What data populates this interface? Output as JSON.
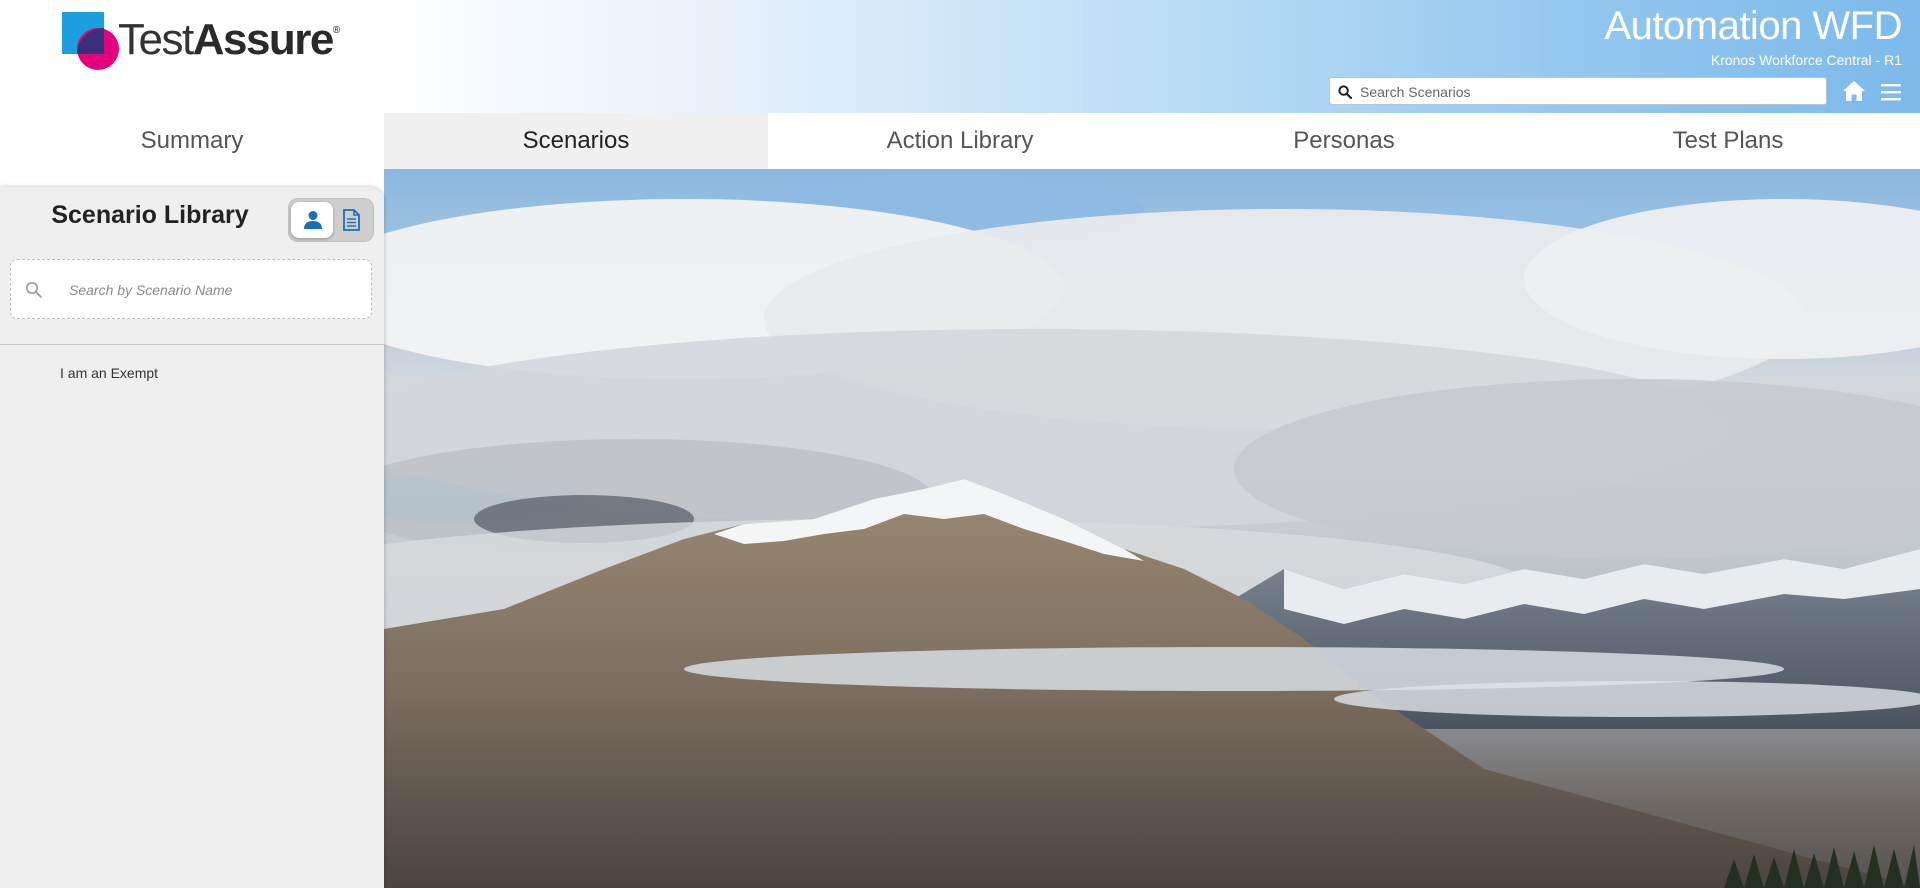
{
  "header": {
    "logo_text_light": "Test",
    "logo_text_bold": "Assure",
    "logo_registered": "®",
    "app_title": "Automation WFD",
    "app_subtitle": "Kronos Workforce Central - R1",
    "search_placeholder": "Search Scenarios",
    "icons": {
      "search": "search-icon",
      "home": "home-icon",
      "menu": "hamburger-menu-icon"
    }
  },
  "nav": {
    "tabs": [
      {
        "label": "Summary"
      },
      {
        "label": "Scenarios"
      },
      {
        "label": "Action Library"
      },
      {
        "label": "Personas"
      },
      {
        "label": "Test Plans"
      }
    ],
    "active": "Scenarios"
  },
  "sidebar": {
    "title": "Scenario Library",
    "view_toggle": {
      "options": [
        "persona-icon",
        "document-icon"
      ],
      "selected": "persona-icon"
    },
    "search_placeholder": "Search by Scenario Name",
    "items": [
      {
        "label": "I am an Exempt"
      }
    ]
  },
  "hero": {
    "description_icon": "mountain-landscape-image"
  },
  "colors": {
    "accent_blue": "#1a6fb5",
    "logo_cyan": "#1aa0dc",
    "logo_magenta": "#e5007e",
    "header_gradient_end": "#7cbaea",
    "active_tab_bg": "#f0f0f0",
    "sidebar_bg": "#efefef"
  }
}
